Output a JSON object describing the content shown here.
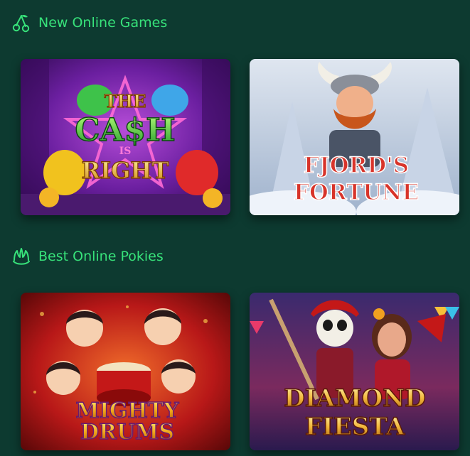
{
  "sections": [
    {
      "title": "New Online Games",
      "icon": "cherries-icon",
      "games": [
        {
          "title_lines": [
            "THE",
            "CA$H",
            "IS",
            "RIGHT"
          ]
        },
        {
          "title_lines": [
            "FJORD'S",
            "FORTUNE"
          ]
        }
      ]
    },
    {
      "title": "Best Online Pokies",
      "icon": "crown-icon",
      "games": [
        {
          "title_lines": [
            "MIGHTY",
            "DRUMS"
          ]
        },
        {
          "title_lines": [
            "DIAMOND",
            "FIESTA"
          ]
        }
      ]
    }
  ],
  "colors": {
    "background": "#0d3a30",
    "accent": "#37e27a"
  }
}
